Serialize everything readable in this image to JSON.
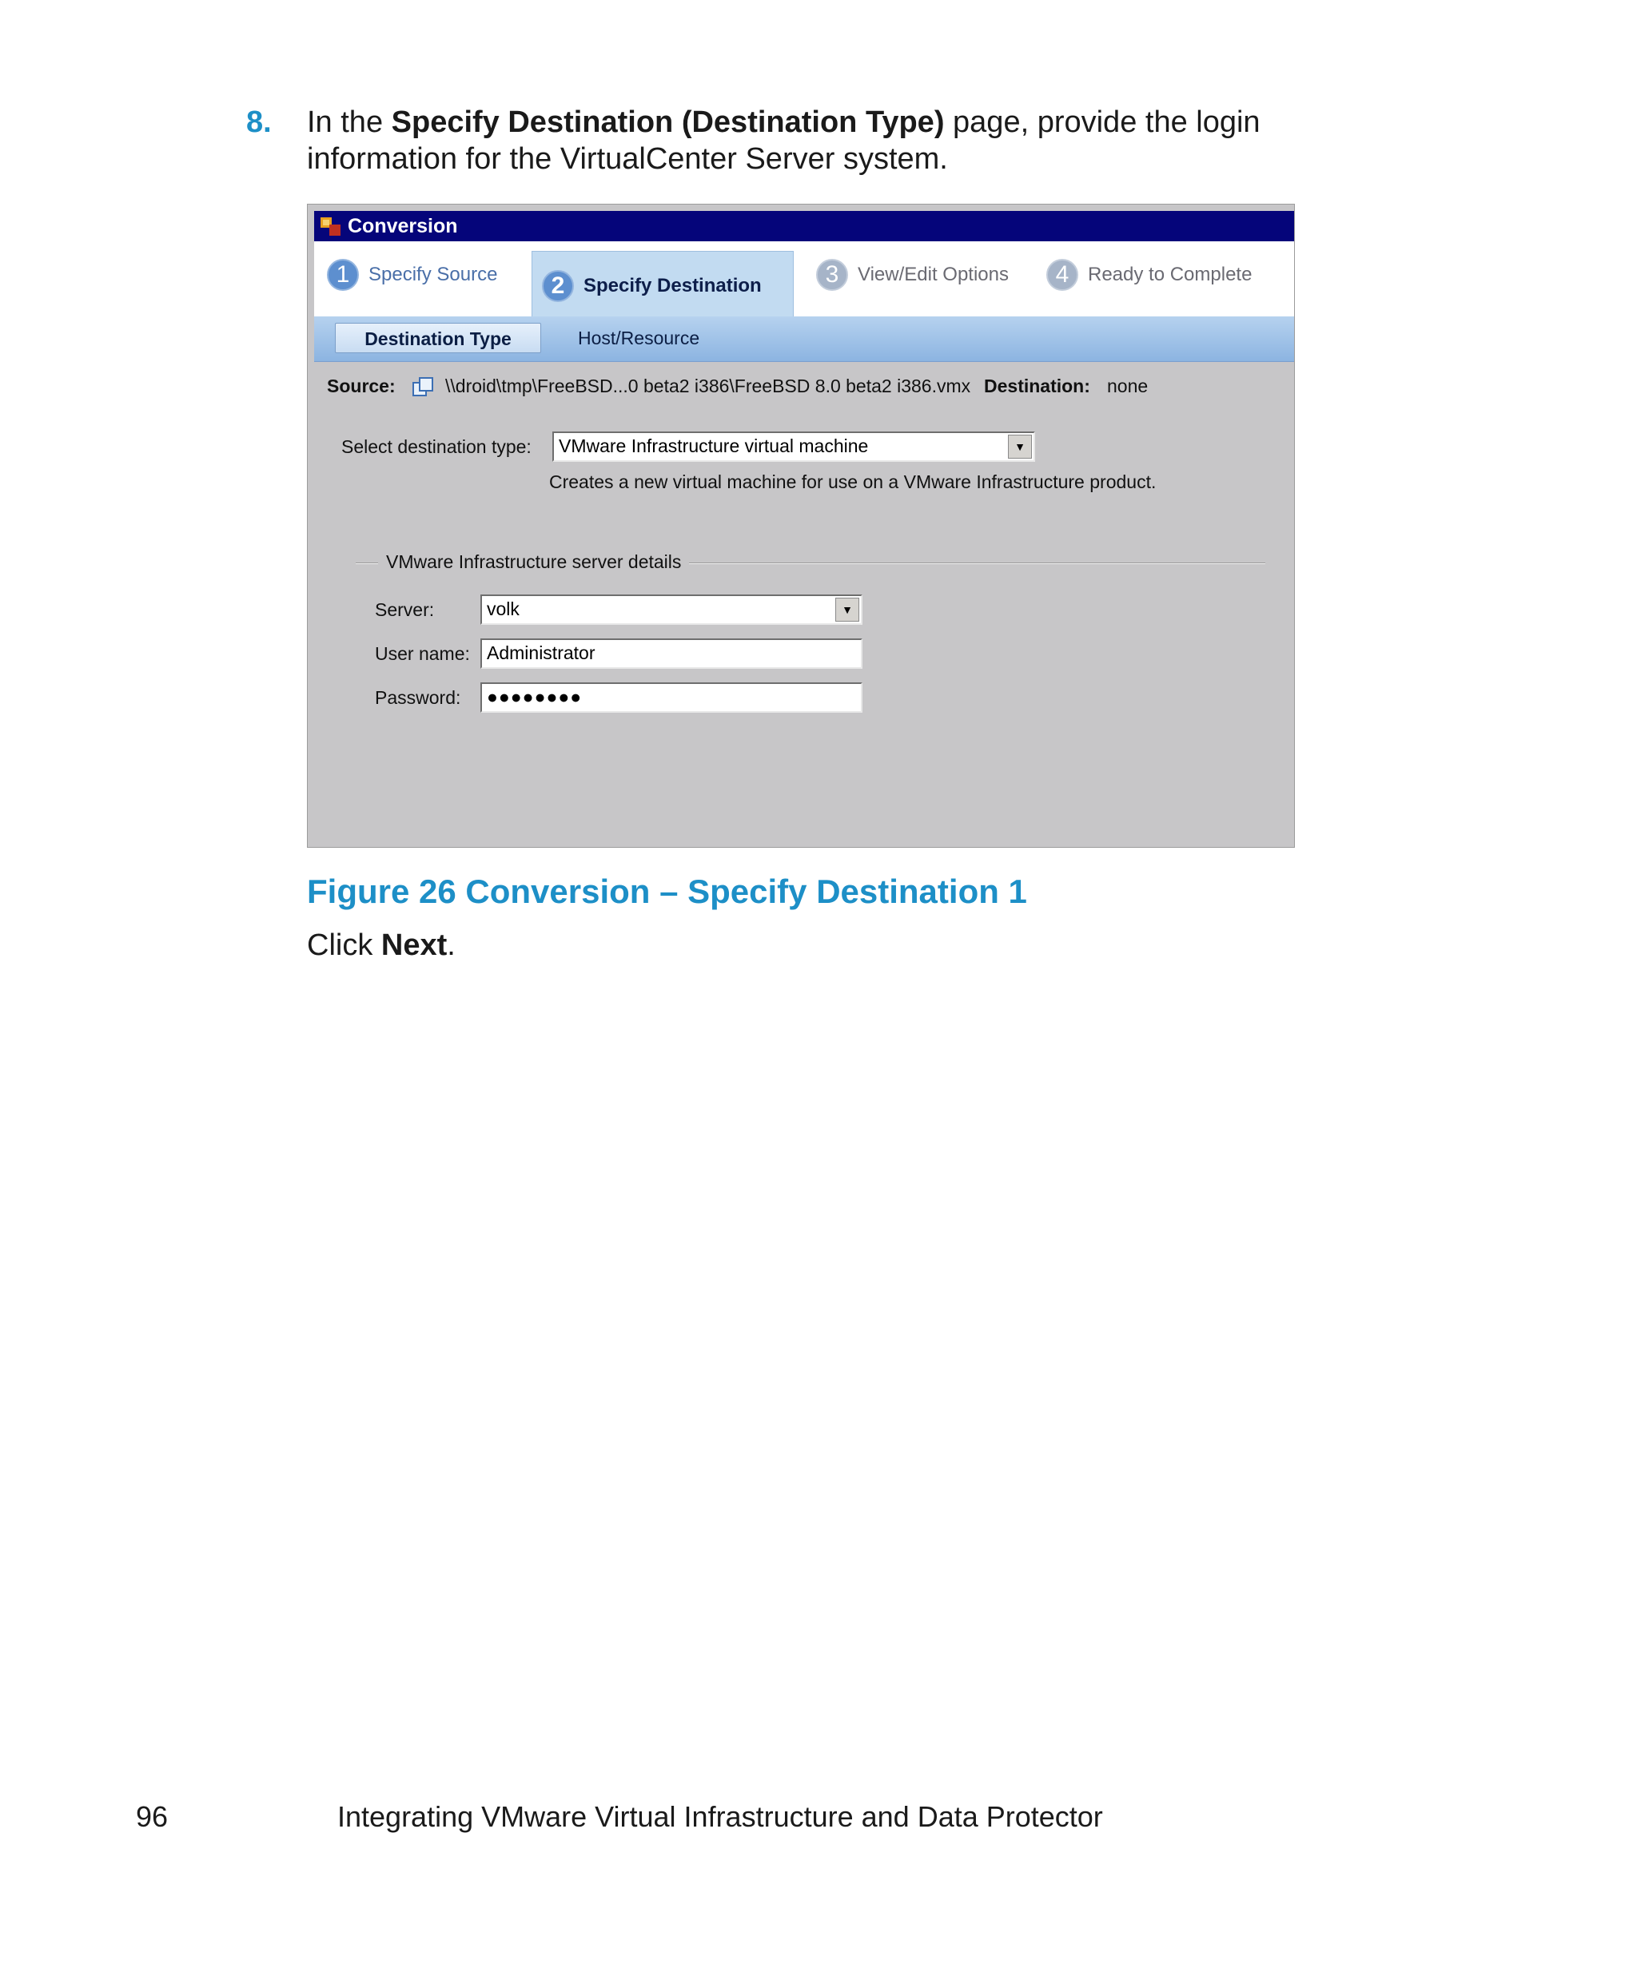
{
  "step": {
    "number": "8.",
    "text_before": "In the ",
    "bold": "Specify Destination (Destination Type)",
    "text_after": " page, provide the login information for the VirtualCenter Server system."
  },
  "window": {
    "title": "Conversion",
    "steps": [
      {
        "num": "1",
        "label": "Specify Source"
      },
      {
        "num": "2",
        "label": "Specify Destination"
      },
      {
        "num": "3",
        "label": "View/Edit Options"
      },
      {
        "num": "4",
        "label": "Ready to Complete"
      }
    ],
    "subtabs": [
      "Destination Type",
      "Host/Resource"
    ],
    "source_label": "Source:",
    "source_value": "\\\\droid\\tmp\\FreeBSD...0 beta2 i386\\FreeBSD 8.0 beta2 i386.vmx",
    "destination_label": "Destination:",
    "destination_value": "none",
    "dest_type_label": "Select destination type:",
    "dest_type_value": "VMware Infrastructure virtual machine",
    "dest_type_desc": "Creates a new virtual machine for use on a VMware Infrastructure product.",
    "group_title": "VMware Infrastructure server details",
    "server_label": "Server:",
    "server_value": "volk",
    "username_label": "User name:",
    "username_value": "Administrator",
    "password_label": "Password:",
    "password_value": "●●●●●●●●"
  },
  "caption": "Figure 26 Conversion – Specify Destination 1",
  "instruction": {
    "prefix": "Click ",
    "bold": "Next",
    "suffix": "."
  },
  "footer": {
    "page_number": "96",
    "title": "Integrating VMware Virtual Infrastructure and Data Protector"
  }
}
